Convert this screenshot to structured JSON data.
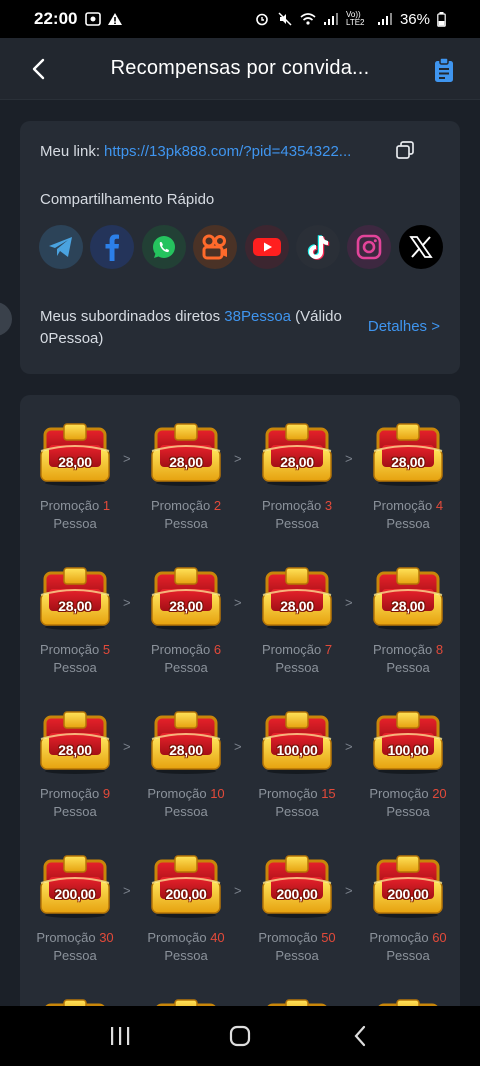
{
  "status_bar": {
    "time": "22:00",
    "battery": "36%",
    "network": "Vo)) LTE2"
  },
  "header": {
    "title": "Recompensas por convida...",
    "back_icon": "chevron-left-icon",
    "action_icon": "clipboard-icon"
  },
  "invite": {
    "link_label": "Meu link:",
    "link_url": "https://13pk888.com/?pid=4354322...",
    "share_title": "Compartilhamento Rápido",
    "share_targets": [
      "telegram",
      "facebook",
      "whatsapp",
      "kwai",
      "youtube",
      "tiktok",
      "instagram",
      "x"
    ],
    "subordinates_prefix": "Meus subordinados diretos ",
    "subordinates_count": "38Pessoa",
    "subordinates_suffix": " (Válido 0Pessoa)",
    "details_label": "Detalhes >"
  },
  "rewards": [
    {
      "amount": "28,00",
      "label": "Promoção",
      "count": "1",
      "unit": "Pessoa"
    },
    {
      "amount": "28,00",
      "label": "Promoção",
      "count": "2",
      "unit": "Pessoa"
    },
    {
      "amount": "28,00",
      "label": "Promoção",
      "count": "3",
      "unit": "Pessoa"
    },
    {
      "amount": "28,00",
      "label": "Promoção",
      "count": "4",
      "unit": "Pessoa"
    },
    {
      "amount": "28,00",
      "label": "Promoção",
      "count": "5",
      "unit": "Pessoa"
    },
    {
      "amount": "28,00",
      "label": "Promoção",
      "count": "6",
      "unit": "Pessoa"
    },
    {
      "amount": "28,00",
      "label": "Promoção",
      "count": "7",
      "unit": "Pessoa"
    },
    {
      "amount": "28,00",
      "label": "Promoção",
      "count": "8",
      "unit": "Pessoa"
    },
    {
      "amount": "28,00",
      "label": "Promoção",
      "count": "9",
      "unit": "Pessoa"
    },
    {
      "amount": "28,00",
      "label": "Promoção",
      "count": "10",
      "unit": "Pessoa"
    },
    {
      "amount": "100,00",
      "label": "Promoção",
      "count": "15",
      "unit": "Pessoa"
    },
    {
      "amount": "100,00",
      "label": "Promoção",
      "count": "20",
      "unit": "Pessoa"
    },
    {
      "amount": "200,00",
      "label": "Promoção",
      "count": "30",
      "unit": "Pessoa"
    },
    {
      "amount": "200,00",
      "label": "Promoção",
      "count": "40",
      "unit": "Pessoa"
    },
    {
      "amount": "200,00",
      "label": "Promoção",
      "count": "50",
      "unit": "Pessoa"
    },
    {
      "amount": "200,00",
      "label": "Promoção",
      "count": "60",
      "unit": "Pessoa"
    }
  ],
  "arrow_glyph": ">",
  "colors": {
    "accent": "#3f95ef",
    "count_red": "#e24a3a",
    "background": "#1b2028",
    "card": "#262c35"
  }
}
